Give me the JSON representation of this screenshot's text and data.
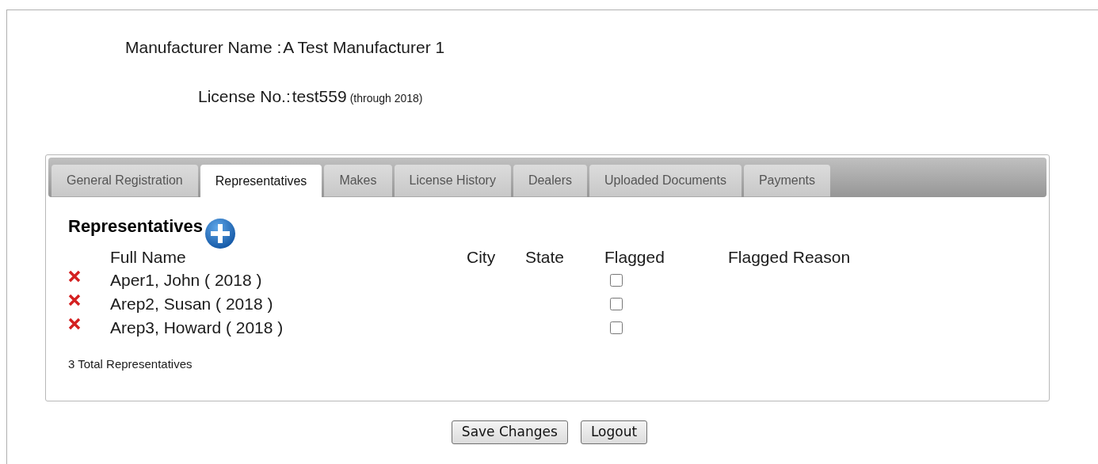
{
  "header": {
    "manufacturer_label": "Manufacturer Name :",
    "manufacturer_value": "A Test Manufacturer 1",
    "license_label": "License No.:",
    "license_value": "test559",
    "license_note": "(through 2018)"
  },
  "tabs": [
    {
      "label": "General Registration",
      "selected": false
    },
    {
      "label": "Representatives",
      "selected": true
    },
    {
      "label": "Makes",
      "selected": false
    },
    {
      "label": "License History",
      "selected": false
    },
    {
      "label": "Dealers",
      "selected": false
    },
    {
      "label": "Uploaded Documents",
      "selected": false
    },
    {
      "label": "Payments",
      "selected": false
    }
  ],
  "section_title": "Representatives",
  "table": {
    "columns": [
      "Full Name",
      "City",
      "State",
      "Flagged",
      "Flagged Reason"
    ],
    "rows": [
      {
        "full_name": "Aper1, John ( 2018 )",
        "flagged": false
      },
      {
        "full_name": "Arep2, Susan ( 2018 )",
        "flagged": false
      },
      {
        "full_name": "Arep3, Howard ( 2018 )",
        "flagged": false
      }
    ]
  },
  "total": "3 Total Representatives",
  "buttons": [
    "Save Changes",
    "Logout"
  ]
}
